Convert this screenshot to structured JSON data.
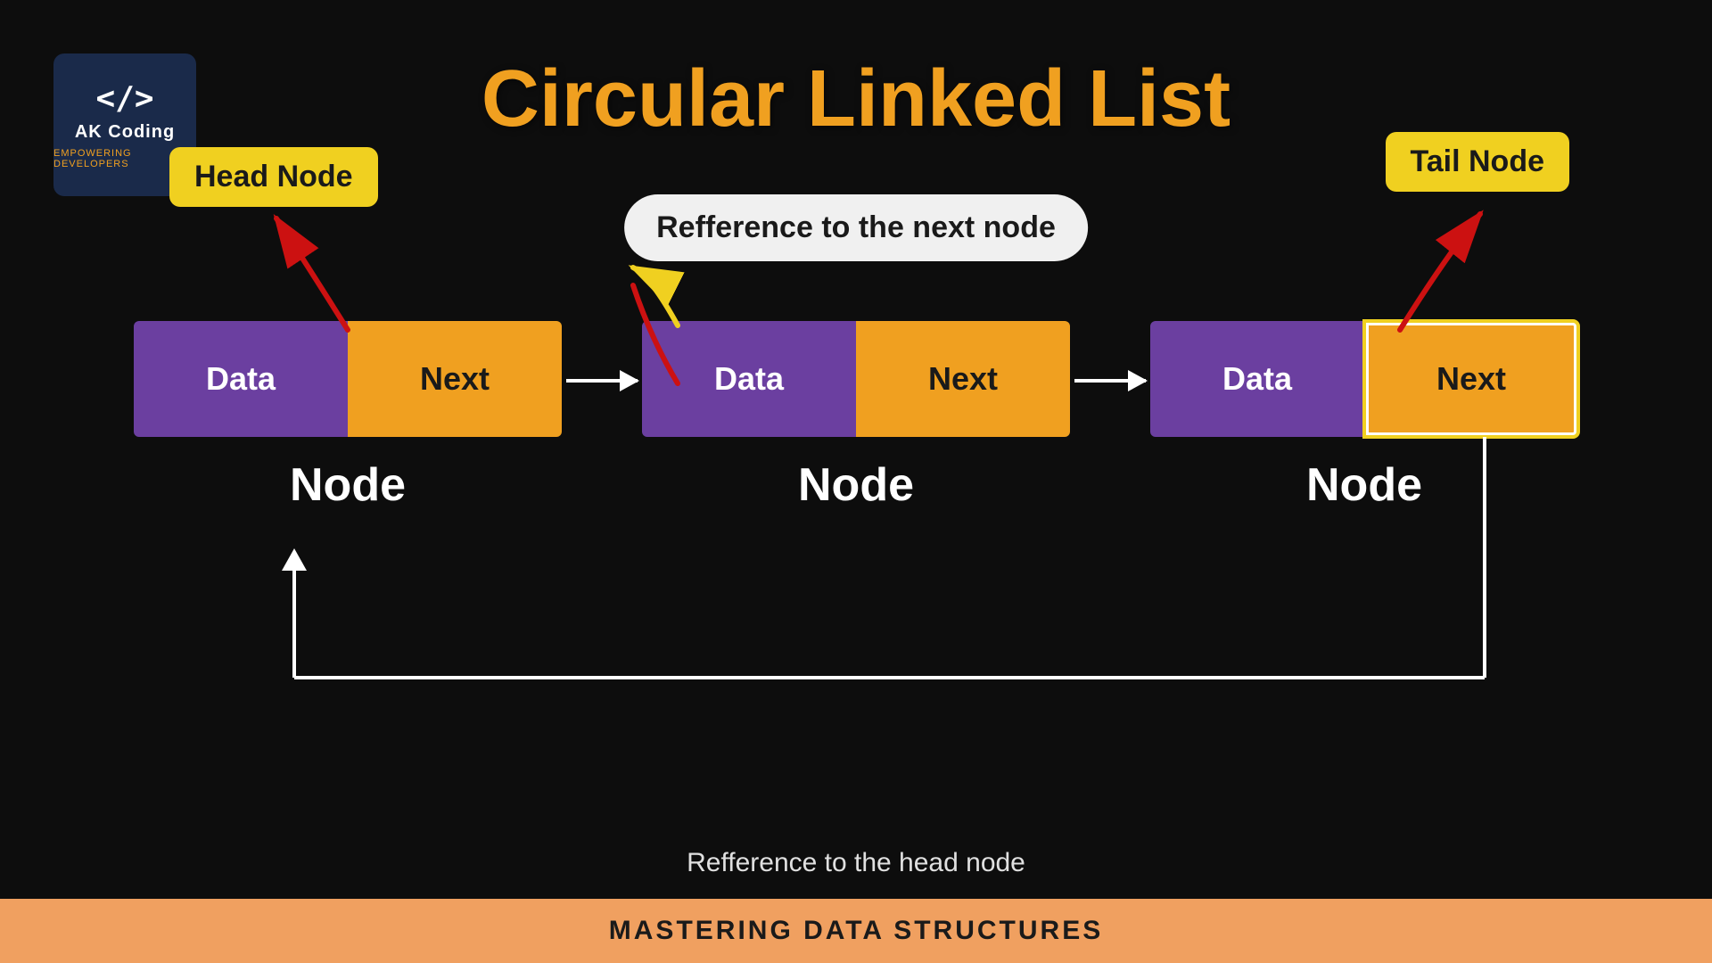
{
  "logo": {
    "icon": "</>",
    "title": "AK Coding",
    "subtitle": "Empowering Developers"
  },
  "title": "Circular Linked List",
  "head_node_label": "Head Node",
  "tail_node_label": "Tail Node",
  "ref_next_label": "Refference to the next node",
  "ref_head_label": "Refference to the head node",
  "nodes": [
    {
      "data": "Data",
      "next": "Next",
      "label": "Node",
      "highlighted": false
    },
    {
      "data": "Data",
      "next": "Next",
      "label": "Node",
      "highlighted": false
    },
    {
      "data": "Data",
      "next": "Next",
      "label": "Node",
      "highlighted": true
    }
  ],
  "bottom_bar": "Mastering Data Structures",
  "colors": {
    "purple": "#6b3fa0",
    "yellow": "#f0a020",
    "background": "#0d0d0d",
    "bottom_bar": "#f0a060"
  }
}
